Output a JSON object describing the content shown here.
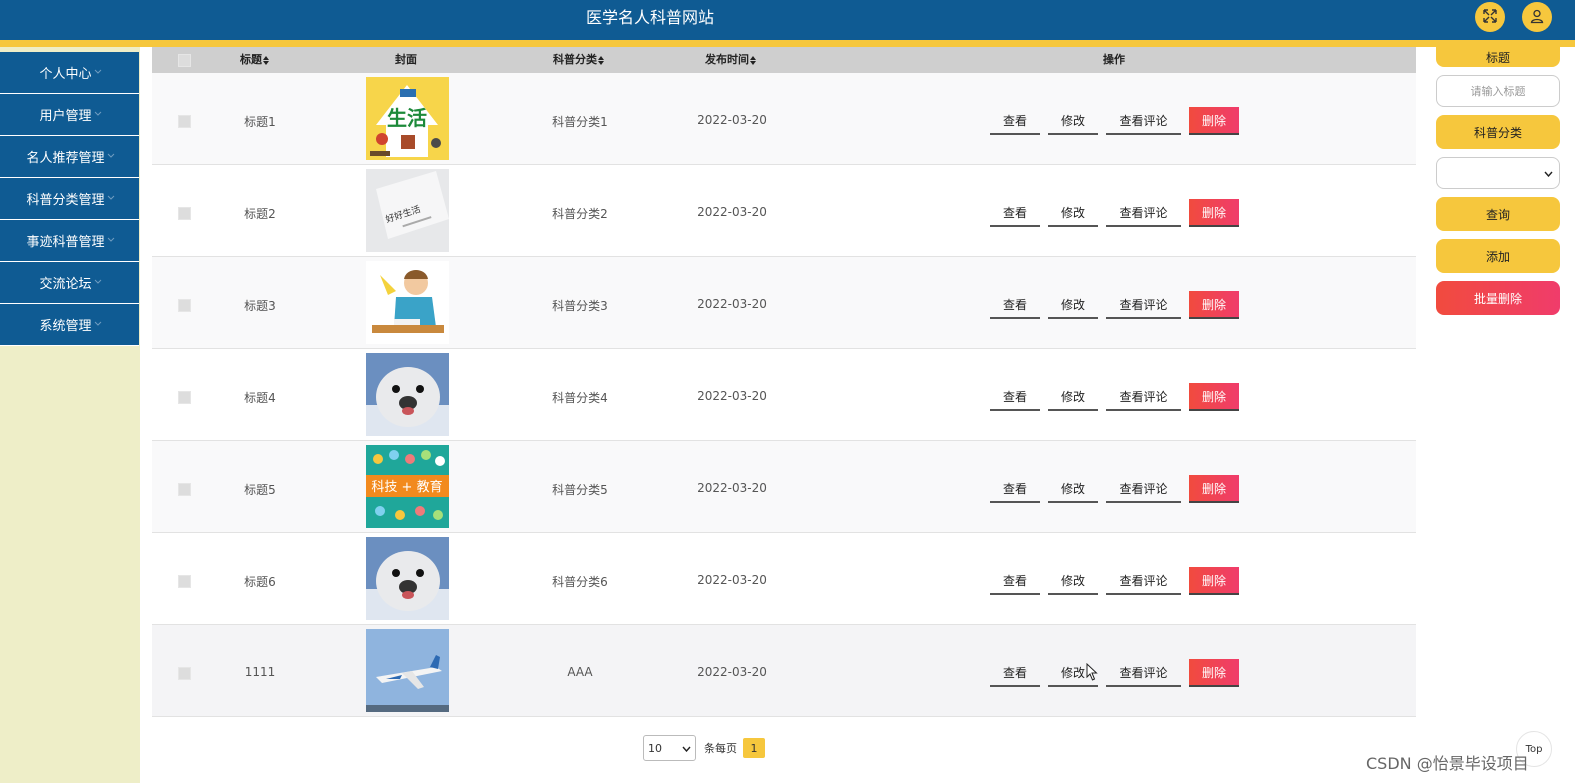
{
  "header": {
    "title": "医学名人科普网站"
  },
  "sidebar": {
    "items": [
      {
        "label": "个人中心"
      },
      {
        "label": "用户管理"
      },
      {
        "label": "名人推荐管理"
      },
      {
        "label": "科普分类管理"
      },
      {
        "label": "事迹科普管理"
      },
      {
        "label": "交流论坛"
      },
      {
        "label": "系统管理"
      }
    ]
  },
  "table": {
    "columns": {
      "title": "标题",
      "cover": "封面",
      "category": "科普分类",
      "time": "发布时间",
      "ops": "操作"
    },
    "ops": {
      "view": "查看",
      "edit": "修改",
      "comments": "查看评论",
      "delete": "删除"
    },
    "rows": [
      {
        "title": "标题1",
        "category": "科普分类1",
        "time": "2022-03-20",
        "cover": "life-poster"
      },
      {
        "title": "标题2",
        "category": "科普分类2",
        "time": "2022-03-20",
        "cover": "paper-card"
      },
      {
        "title": "标题3",
        "category": "科普分类3",
        "time": "2022-03-20",
        "cover": "cartoon-boy"
      },
      {
        "title": "标题4",
        "category": "科普分类4",
        "time": "2022-03-20",
        "cover": "seal"
      },
      {
        "title": "标题5",
        "category": "科普分类5",
        "time": "2022-03-20",
        "cover": "tech-edu"
      },
      {
        "title": "标题6",
        "category": "科普分类6",
        "time": "2022-03-20",
        "cover": "seal"
      },
      {
        "title": "1111",
        "category": "AAA",
        "time": "2022-03-20",
        "cover": "airplane"
      }
    ]
  },
  "covers": {
    "life_text": "生活",
    "paper_text": "好好生活",
    "tech_text": "科技 + 教育"
  },
  "search": {
    "title_label": "标题",
    "title_placeholder": "请输入标题",
    "category_label": "科普分类",
    "query_button": "查询",
    "add_button": "添加",
    "batch_delete_button": "批量删除"
  },
  "pager": {
    "page_size": "10",
    "per_page_label": "条每页",
    "current_page": "1"
  },
  "top_button": "Top",
  "watermark": "CSDN @怡景毕设项目",
  "colors": {
    "primary": "#0f5b93",
    "accent": "#f6c73d",
    "danger": "#f03c6b",
    "sidebar_bg": "#eeeec8"
  }
}
